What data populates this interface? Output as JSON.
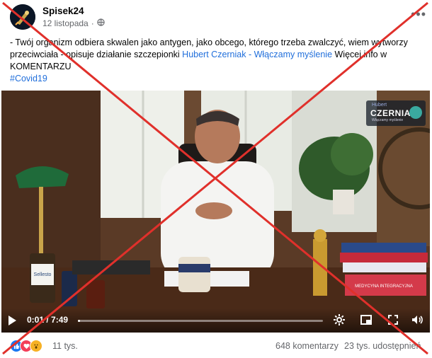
{
  "post": {
    "author": "Spisek24",
    "date": "12 listopada",
    "date_separator": "·",
    "privacy_icon": "globe-icon",
    "more_label": "•••",
    "text_before": "- Twój organizm odbiera skwalen jako antygen, jako obcego, którego trzeba zwalczyć, wiem wytworzy przeciwciała - opisuje działanie szczepionki ",
    "link_text": "Hubert Czerniak - Włączamy myślenie",
    "text_after": " Więcej info w KOMENTARZU",
    "hashtag": "#Covid19"
  },
  "video": {
    "time": "0:01 / 7:49",
    "progress": 0.01,
    "watermark_small": "Hubert",
    "watermark_name": "CZERNIAK",
    "watermark_sub": "Włączamy myślenie",
    "bottle_label": "Sellesto",
    "book_label": "MEDYCYNA INTEGRACYJNA"
  },
  "footer": {
    "reaction_count": "11 tys.",
    "comments": "648 komentarzy",
    "shares": "23 tys. udostępnień"
  },
  "colors": {
    "link": "#216fdb",
    "cross": "#e0302b"
  }
}
